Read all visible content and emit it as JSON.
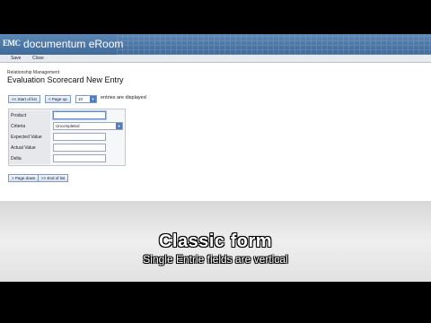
{
  "header": {
    "logo_brand": "EMC",
    "logo_product": "documentum eRoom"
  },
  "toolbar": {
    "save_label": "Save",
    "close_label": "Close"
  },
  "breadcrumb": "Relationship Management",
  "page_title": "Evaluation Scorecard New Entry",
  "pager_top": {
    "start_label": "<< Start of list",
    "pageup_label": "< Page up",
    "count_value": "10",
    "entries_label": "entries are displayed"
  },
  "form": {
    "rows": [
      {
        "label": "Product",
        "value": ""
      },
      {
        "label": "Criteria",
        "value": "Uncompleted"
      },
      {
        "label": "Expected Value",
        "value": ""
      },
      {
        "label": "Actual Value",
        "value": ""
      },
      {
        "label": "Delta",
        "value": ""
      }
    ]
  },
  "pager_bottom": {
    "pagedown_label": "> Page down",
    "end_label": ">> End of list"
  },
  "caption": {
    "title": "Classic form",
    "subtitle": "Single Entrie fields are vertical"
  },
  "colors": {
    "header_blue": "#3f6a99",
    "button_border": "#7f9cc0",
    "dropdown_blue": "#4f7cc0"
  }
}
